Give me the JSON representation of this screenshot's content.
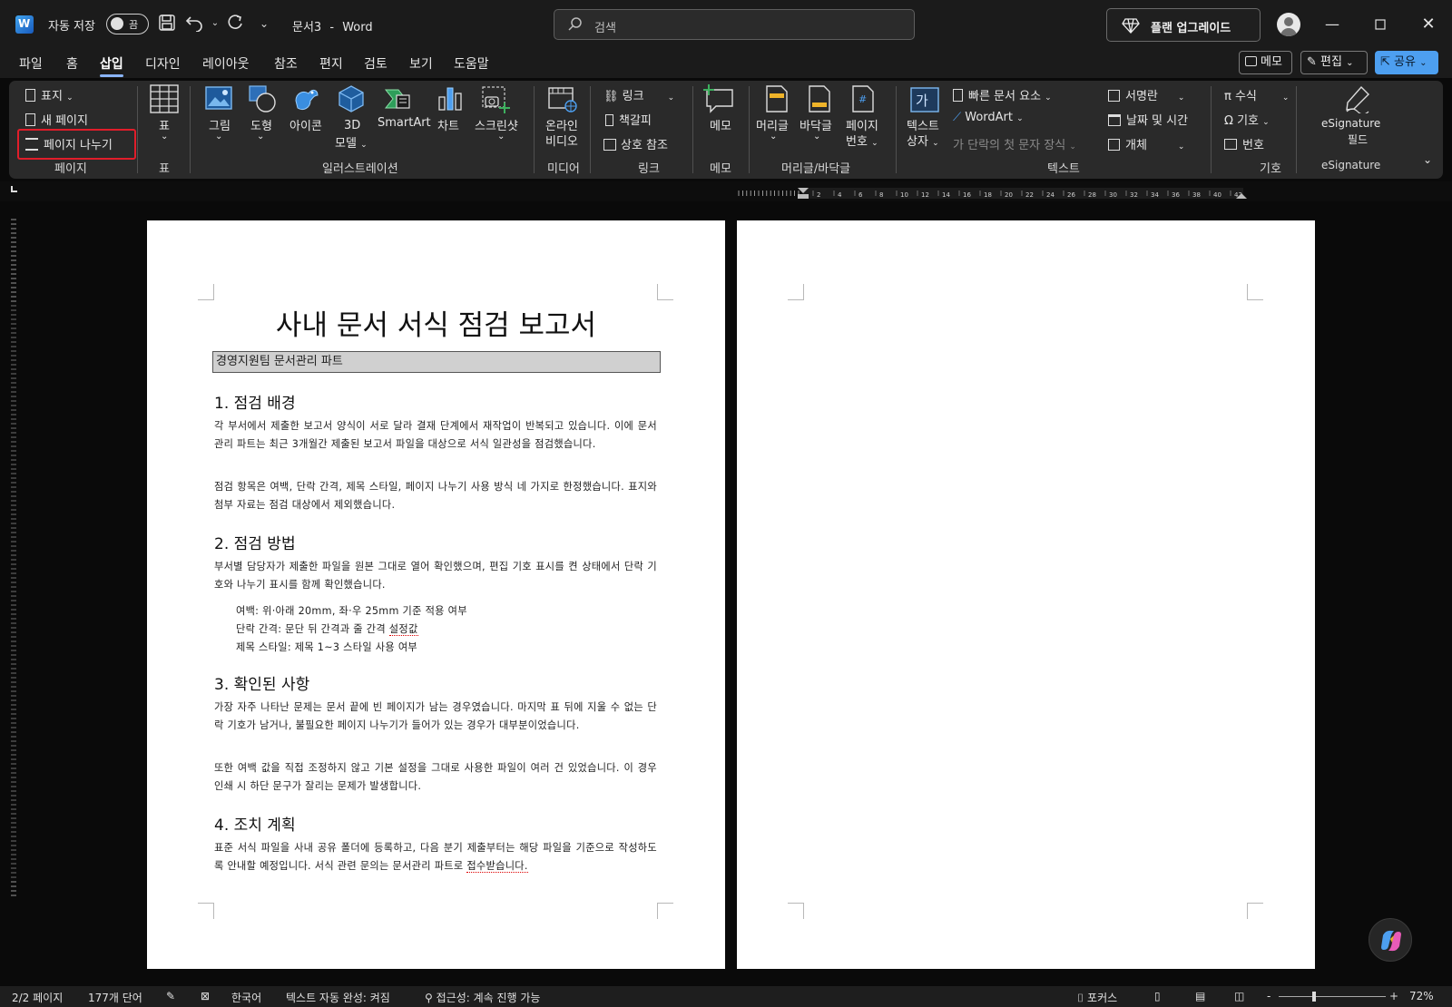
{
  "titlebar": {
    "autosave_label": "자동 저장",
    "autosave_state": "끔",
    "doc_name": "문서3",
    "separator": "-",
    "app_name": "Word",
    "search_placeholder": "검색",
    "upgrade_label": "플랜 업그레이드"
  },
  "menu": {
    "tabs": [
      "파일",
      "홈",
      "삽입",
      "디자인",
      "레이아웃",
      "참조",
      "편지",
      "검토",
      "보기",
      "도움말"
    ],
    "active_tab": "삽입",
    "memo_label": "메모",
    "edit_label": "편집",
    "share_label": "공유"
  },
  "ribbon": {
    "page_group": {
      "cover": "표지",
      "new_page": "새 페이지",
      "page_break": "페이지 나누기",
      "label": "페이지"
    },
    "table_group": {
      "table": "표",
      "label": "표"
    },
    "illust_group": {
      "picture": "그림",
      "shapes": "도형",
      "icons": "아이콘",
      "model3d_1": "3D",
      "model3d_2": "모델",
      "smartart": "SmartArt",
      "chart": "차트",
      "screenshot": "스크린샷",
      "label": "일러스트레이션"
    },
    "media_group": {
      "video_1": "온라인",
      "video_2": "비디오",
      "label": "미디어"
    },
    "link_group": {
      "link": "링크",
      "bookmark": "책갈피",
      "crossref": "상호 참조",
      "label": "링크"
    },
    "comment_group": {
      "comment": "메모",
      "label": "메모"
    },
    "hf_group": {
      "header": "머리글",
      "footer": "바닥글",
      "pagenum_1": "페이지",
      "pagenum_2": "번호",
      "label": "머리글/바닥글"
    },
    "text_group": {
      "textbox_1": "텍스트",
      "textbox_2": "상자",
      "quickparts": "빠른 문서 요소",
      "wordart": "WordArt",
      "dropcap": "단락의 첫 문자 장식",
      "signature": "서명란",
      "datetime": "날짜 및 시간",
      "object": "개체",
      "label": "텍스트"
    },
    "symbol_group": {
      "equation": "수식",
      "symbol": "기호",
      "number": "번호",
      "label": "기호"
    },
    "esig_group": {
      "field_1": "eSignature",
      "field_2": "필드",
      "label": "eSignature"
    }
  },
  "ruler_numbers": [
    "2",
    "4",
    "6",
    "8",
    "10",
    "12",
    "14",
    "16",
    "18",
    "20",
    "22",
    "24",
    "26",
    "28",
    "30",
    "32",
    "34",
    "36",
    "38",
    "40",
    "42"
  ],
  "document": {
    "title": "사내 문서 서식 점검 보고서",
    "subtitle": "경영지원팀 문서관리 파트",
    "s1_heading": "1. 점검 배경",
    "s1_p1": "각 부서에서 제출한 보고서 양식이 서로 달라 결재 단계에서 재작업이 반복되고 있습니다. 이에 문서관리 파트는 최근 3개월간 제출된 보고서 파일을 대상으로 서식 일관성을 점검했습니다.",
    "s1_p2": "점검 항목은 여백, 단락 간격, 제목 스타일, 페이지 나누기 사용 방식 네 가지로 한정했습니다. 표지와 첨부 자료는 점검 대상에서 제외했습니다.",
    "s2_heading": "2. 점검 방법",
    "s2_p1": "부서별 담당자가 제출한 파일을 원본 그대로 열어 확인했으며, 편집 기호 표시를 켠 상태에서 단락 기호와 나누기 표시를 함께 확인했습니다.",
    "s2_li1": "여백: 위·아래 20mm, 좌·우 25mm 기준 적용 여부",
    "s2_li2_a": "단락 간격: 문단 뒤 간격과 줄 간격 ",
    "s2_li2_b": "설정값",
    "s2_li3": "제목 스타일: 제목 1~3 스타일 사용 여부",
    "s3_heading": "3. 확인된 사항",
    "s3_p1": "가장 자주 나타난 문제는 문서 끝에 빈 페이지가 남는 경우였습니다. 마지막 표 뒤에 지울 수 없는 단락 기호가 남거나, 불필요한 페이지 나누기가 들어가 있는 경우가 대부분이었습니다.",
    "s3_p2": "또한 여백 값을 직접 조정하지 않고 기본 설정을 그대로 사용한 파일이 여러 건 있었습니다. 이 경우 인쇄 시 하단 문구가 잘리는 문제가 발생합니다.",
    "s4_heading": "4. 조치 계획",
    "s4_p1_a": "표준 서식 파일을 사내 공유 폴더에 등록하고, 다음 분기 제출부터는 해당 파일을 기준으로 작성하도록 안내할 예정입니다. 서식 관련 문의는 문서관리 파트로 ",
    "s4_p1_b": "접수받습니다."
  },
  "status": {
    "pages": "2/2 페이지",
    "words": "177개 단어",
    "language": "한국어",
    "autocomplete": "텍스트 자동 완성: 켜짐",
    "accessibility": "접근성: 계속 진행 가능",
    "focus": "포커스",
    "zoom_minus": "-",
    "zoom_plus": "+",
    "zoom": "72%"
  },
  "colors": {
    "accent": "#4d9ff0",
    "highlight": "#e11d2a",
    "ribbon_bg": "#2a2a2a",
    "window_bg": "#1b1b1b"
  }
}
